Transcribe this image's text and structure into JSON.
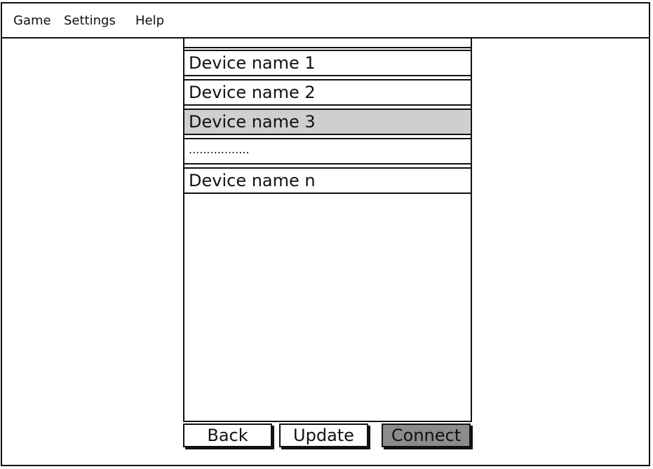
{
  "menu": {
    "game": "Game",
    "settings": "Settings",
    "help": "Help"
  },
  "devices": [
    {
      "label": "Device name 1",
      "selected": false
    },
    {
      "label": "Device name 2",
      "selected": false
    },
    {
      "label": "Device name 3",
      "selected": true
    },
    {
      "label": ".................",
      "selected": false
    },
    {
      "label": "Device name n",
      "selected": false
    }
  ],
  "buttons": {
    "back": "Back",
    "update": "Update",
    "connect": "Connect"
  },
  "colors": {
    "selected_row": "#cfcfcf",
    "connect_button": "#8c8c8c",
    "border": "#111111"
  }
}
